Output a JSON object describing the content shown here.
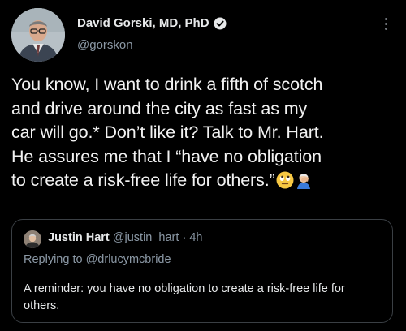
{
  "tweet": {
    "author": {
      "name": "David Gorski, MD, PhD",
      "handle": "@gorskon",
      "verified": true,
      "avatar_icon": "profile-photo-man-with-glasses"
    },
    "more_icon": "vertical-ellipsis-icon",
    "body_lines": [
      "You know, I want to drink a fifth of scotch",
      "and drive around the city as fast as my",
      "car will go.* Don’t like it? Talk to Mr. Hart.",
      "He assures me that I “have no obligation",
      "to create a risk-free life for others.”"
    ],
    "body_emojis": [
      "eye-roll-emoji",
      "facepalm-emoji"
    ]
  },
  "quoted_tweet": {
    "author": {
      "name": "Justin Hart",
      "handle": "@justin_hart",
      "time_sep": "·",
      "time": "4h",
      "avatar_icon": "profile-photo-man"
    },
    "replying_prefix": "Replying to",
    "replying_to": "@drlucymcbride",
    "text": "A reminder: you have no obligation to create a risk-free life for others."
  },
  "colors": {
    "background": "#000000",
    "primary_text": "#e7e9ea",
    "secondary_text": "#8b98a5",
    "border": "#3a3f44"
  }
}
